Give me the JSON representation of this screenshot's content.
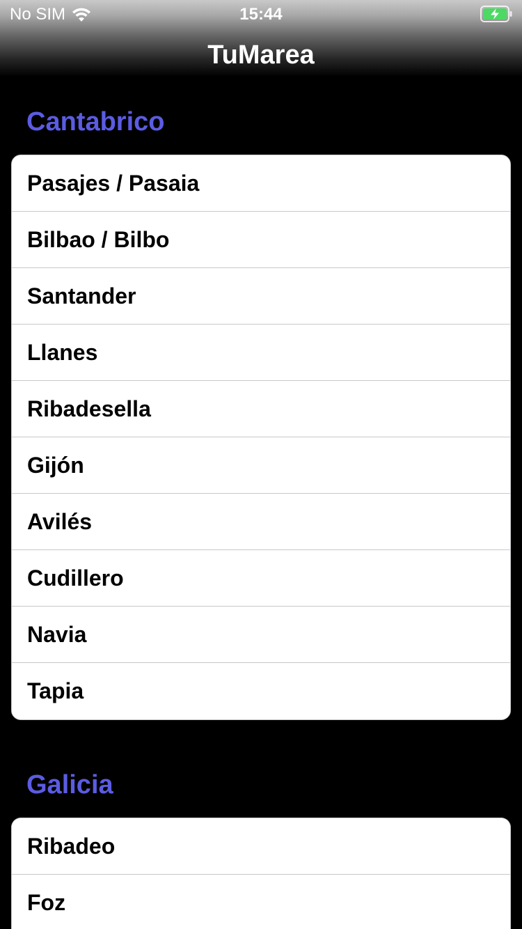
{
  "status_bar": {
    "carrier": "No SIM",
    "time": "15:44",
    "wifi_icon": "wifi-icon",
    "battery_icon": "battery-charging-icon",
    "battery_color": "#4cd964"
  },
  "nav": {
    "title": "TuMarea"
  },
  "colors": {
    "section_header": "#5b5ce2",
    "background": "#000000",
    "row_background": "#ffffff"
  },
  "sections": [
    {
      "title": "Cantabrico",
      "items": [
        "Pasajes / Pasaia",
        "Bilbao / Bilbo",
        "Santander",
        "Llanes",
        "Ribadesella",
        "Gijón",
        "Avilés",
        "Cudillero",
        "Navia",
        "Tapia"
      ]
    },
    {
      "title": "Galicia",
      "items": [
        "Ribadeo",
        "Foz"
      ]
    }
  ]
}
